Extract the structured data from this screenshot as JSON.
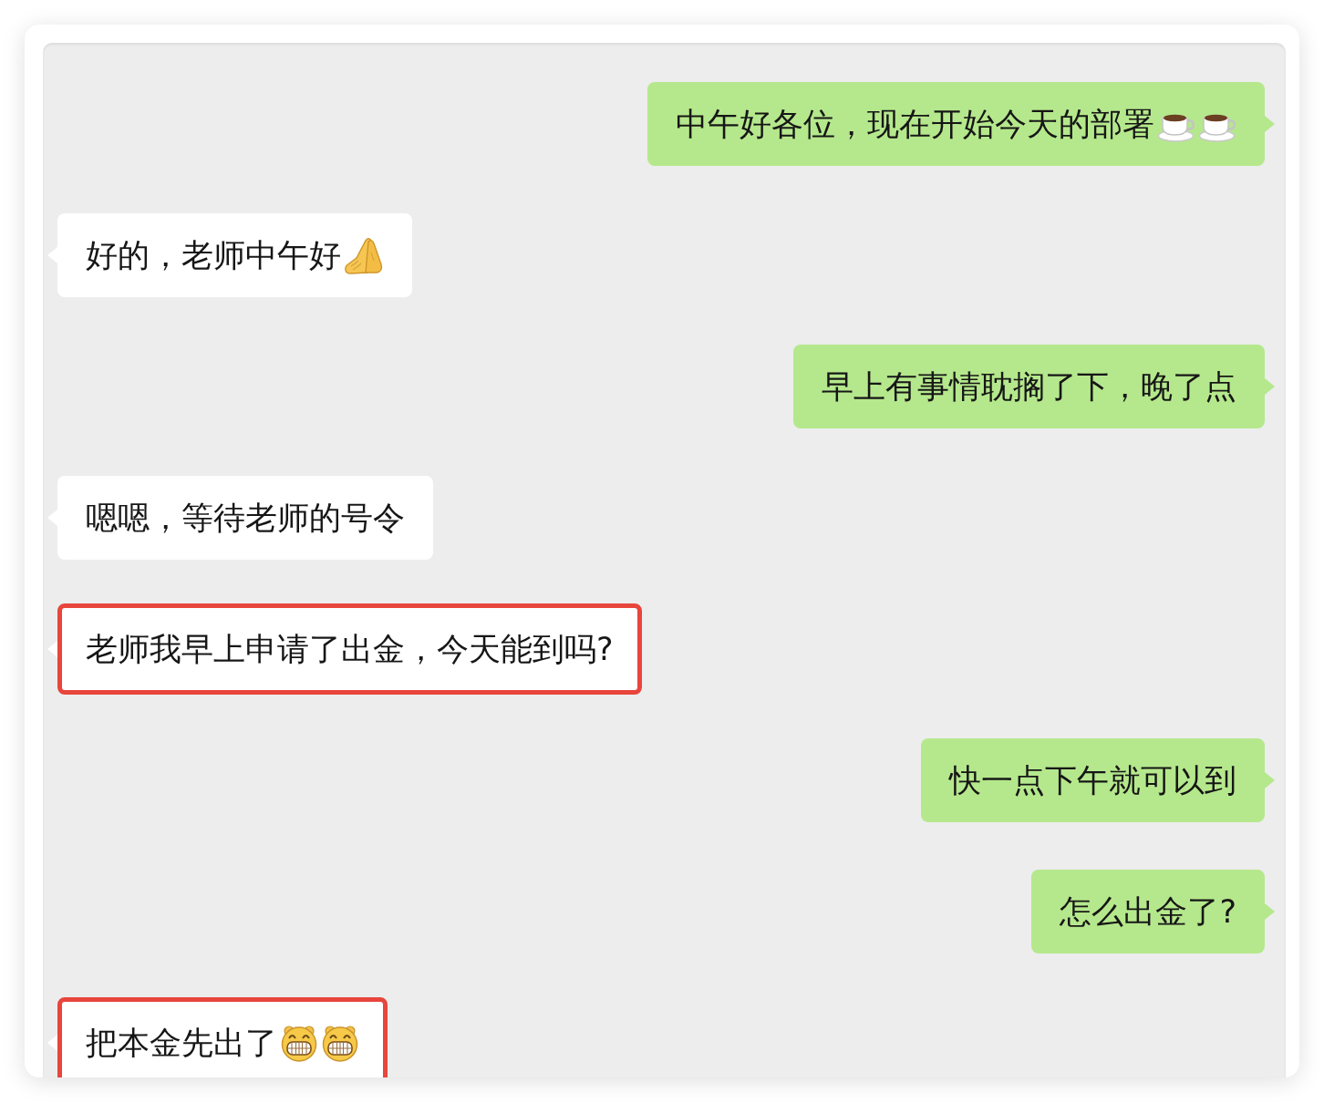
{
  "messages": [
    {
      "kind": "outgoing",
      "text": "中午好各位，现在开始今天的部署",
      "emojis": [
        {
          "kind": "coffee"
        },
        {
          "kind": "coffee"
        }
      ],
      "highlighted": false
    },
    {
      "kind": "incoming",
      "text": "好的，老师中午好",
      "emojis": [
        {
          "kind": "praying-hands"
        }
      ],
      "highlighted": false
    },
    {
      "kind": "outgoing",
      "text": "早上有事情耽搁了下，晚了点",
      "highlighted": false
    },
    {
      "kind": "incoming",
      "text": "嗯嗯，等待老师的号令",
      "highlighted": false
    },
    {
      "kind": "incoming",
      "text": "老师我早上申请了出金，今天能到吗?",
      "highlighted": true
    },
    {
      "kind": "outgoing",
      "text": "快一点下午就可以到",
      "highlighted": false
    },
    {
      "kind": "outgoing",
      "text": "怎么出金了?",
      "highlighted": false
    },
    {
      "kind": "incoming",
      "text": "把本金先出了",
      "emojis": [
        {
          "kind": "grin"
        },
        {
          "kind": "grin"
        }
      ],
      "highlighted": true
    }
  ]
}
